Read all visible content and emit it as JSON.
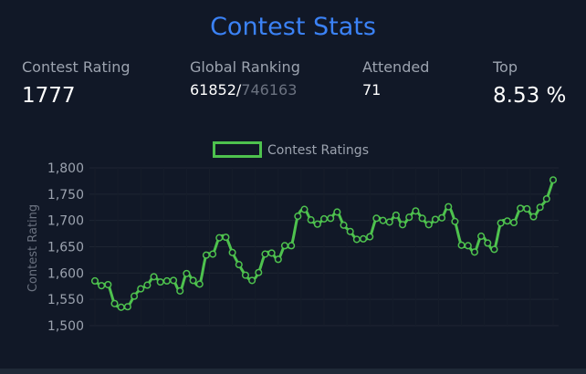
{
  "title": "Contest Stats",
  "stats": {
    "rating_label": "Contest Rating",
    "rating_value": "1777",
    "ranking_label": "Global Ranking",
    "ranking_value": "61852/",
    "ranking_total": "746163",
    "attended_label": "Attended",
    "attended_value": "71",
    "top_label": "Top",
    "top_value": "8.53 %"
  },
  "colors": {
    "accent": "#3b82f6",
    "line": "#4ec24e",
    "background": "#111827"
  },
  "chart_data": {
    "type": "line",
    "title": "",
    "xlabel": "",
    "ylabel": "Contest Rating",
    "ylim": [
      1500,
      1800
    ],
    "yticks": [
      1500,
      1550,
      1600,
      1650,
      1700,
      1750,
      1800
    ],
    "ytick_labels": [
      "1,500",
      "1,550",
      "1,600",
      "1,650",
      "1,700",
      "1,750",
      "1,800"
    ],
    "legend": "top-center",
    "grid": true,
    "series": [
      {
        "name": "Contest Ratings",
        "values": [
          1585,
          1576,
          1578,
          1542,
          1535,
          1536,
          1556,
          1570,
          1577,
          1593,
          1583,
          1585,
          1586,
          1566,
          1599,
          1586,
          1579,
          1634,
          1636,
          1667,
          1668,
          1639,
          1616,
          1596,
          1586,
          1601,
          1636,
          1638,
          1626,
          1652,
          1652,
          1708,
          1721,
          1701,
          1693,
          1703,
          1704,
          1716,
          1691,
          1679,
          1664,
          1665,
          1669,
          1704,
          1700,
          1697,
          1710,
          1692,
          1706,
          1718,
          1704,
          1692,
          1702,
          1705,
          1726,
          1698,
          1653,
          1652,
          1640,
          1670,
          1657,
          1645,
          1695,
          1699,
          1696,
          1723,
          1722,
          1707,
          1725,
          1741,
          1777
        ]
      }
    ]
  }
}
